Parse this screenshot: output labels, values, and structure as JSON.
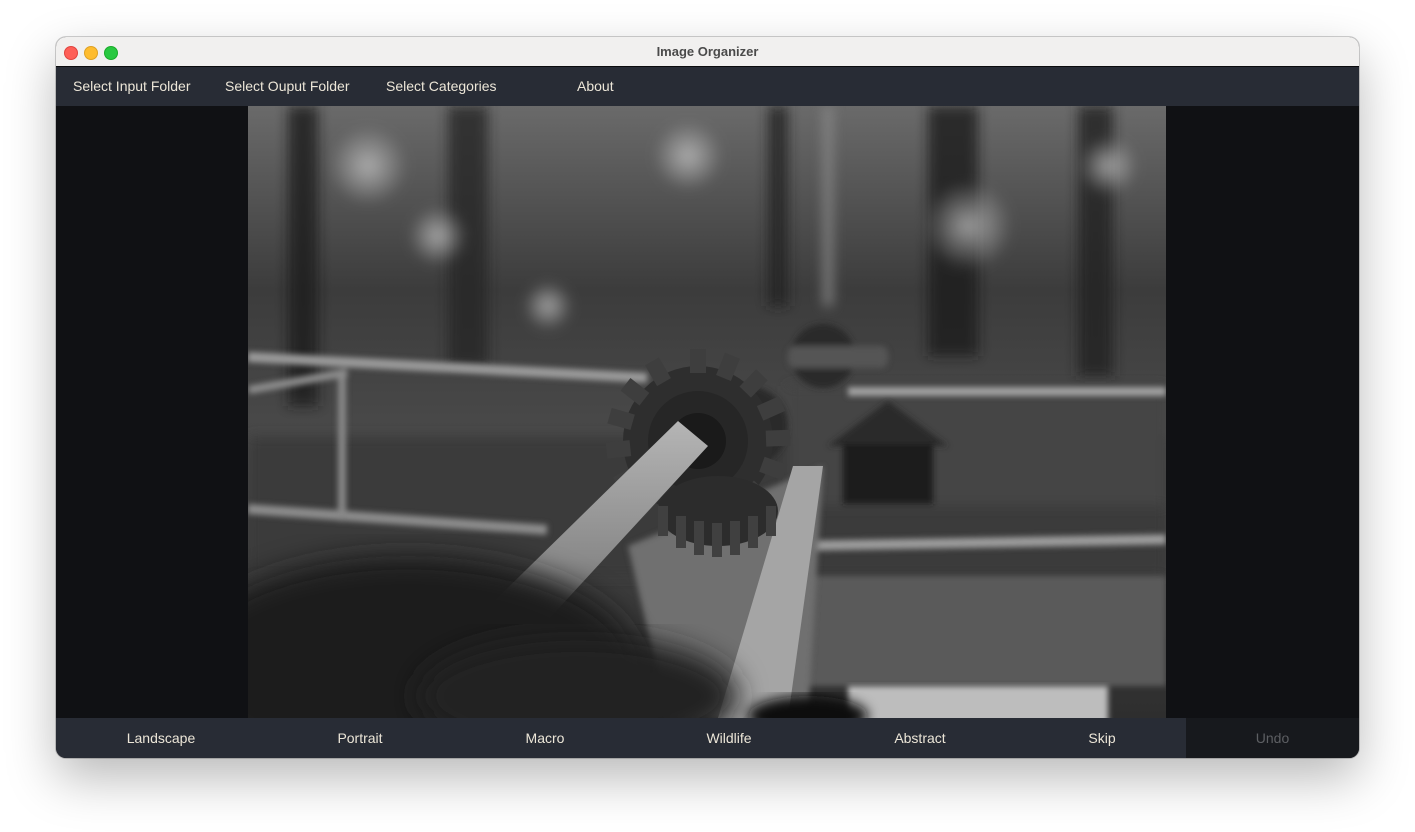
{
  "window": {
    "title": "Image Organizer",
    "controls": [
      "close",
      "minimize",
      "maximize"
    ]
  },
  "menubar": {
    "items": [
      {
        "label": "Select Input Folder"
      },
      {
        "label": "Select Ouput Folder"
      },
      {
        "label": "Select Categories"
      },
      {
        "label": "About"
      }
    ]
  },
  "image": {
    "description": "Black and white photo of bevel gears on a metal rod in a garden",
    "alt": "Grayscale photo of gears on a rod"
  },
  "bottombar": {
    "categories": [
      {
        "label": "Landscape"
      },
      {
        "label": "Portrait"
      },
      {
        "label": "Macro"
      },
      {
        "label": "Wildlife"
      },
      {
        "label": "Abstract"
      }
    ],
    "skip_label": "Skip",
    "undo_label": "Undo",
    "undo_enabled": false
  },
  "colors": {
    "titlebar": "#f1f0ef",
    "menubar": "#282c35",
    "content_bg": "#101114",
    "text": "#ece6d8",
    "disabled_text": "#5d5f63"
  }
}
